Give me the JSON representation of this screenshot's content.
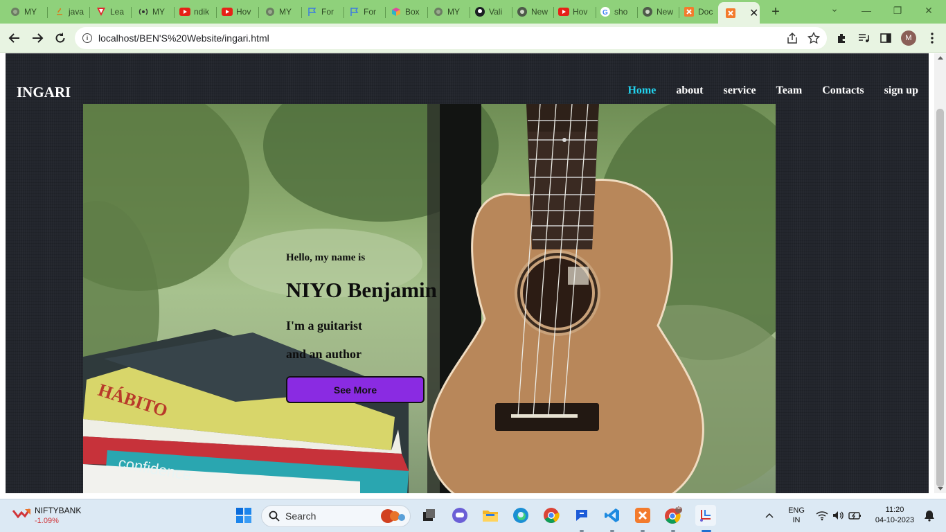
{
  "browser": {
    "tabs": [
      {
        "label": "MY",
        "icon": "globe-icon"
      },
      {
        "label": "java",
        "icon": "java-icon"
      },
      {
        "label": "Lea",
        "icon": "red-v-icon"
      },
      {
        "label": "MY",
        "icon": "podcast-icon"
      },
      {
        "label": "ndik",
        "icon": "youtube-icon"
      },
      {
        "label": "Hov",
        "icon": "youtube-icon"
      },
      {
        "label": "MY",
        "icon": "globe-icon"
      },
      {
        "label": "For",
        "icon": "flag-icon"
      },
      {
        "label": "For",
        "icon": "flag-icon"
      },
      {
        "label": "Box",
        "icon": "box-icon"
      },
      {
        "label": "MY",
        "icon": "globe-icon"
      },
      {
        "label": "Vali",
        "icon": "github-icon"
      },
      {
        "label": "New",
        "icon": "chrome-icon"
      },
      {
        "label": "Hov",
        "icon": "youtube-icon"
      },
      {
        "label": "sho",
        "icon": "google-icon"
      },
      {
        "label": "New",
        "icon": "chrome-icon"
      },
      {
        "label": "Doc",
        "icon": "xampp-icon"
      }
    ],
    "active_tab_icon": "xampp-icon",
    "active_tab_close": "✕",
    "new_tab": "+",
    "url": "localhost/BEN'S%20Website/ingari.html"
  },
  "site": {
    "brand": "INGARI",
    "nav": [
      {
        "label": "Home",
        "active": true
      },
      {
        "label": "about",
        "active": false
      },
      {
        "label": "service",
        "active": false
      },
      {
        "label": "Team",
        "active": false
      },
      {
        "label": "Contacts",
        "active": false
      },
      {
        "label": "sign up",
        "active": false
      }
    ],
    "hero": {
      "greeting": "Hello, my name is",
      "name": "NIYO Benjamin",
      "role_line1": "I'm a guitarist",
      "role_line2": "and an author",
      "button": "See More"
    },
    "colors": {
      "active_nav": "#22d3ee",
      "button": "#8a2be2",
      "page_bg": "#22252c"
    }
  },
  "taskbar": {
    "stock_name": "NIFTYBANK",
    "stock_change": "-1.09%",
    "search_label": "Search",
    "language": "ENG",
    "region": "IN",
    "time": "11:20",
    "date": "04-10-2023",
    "chrome_badge": "M"
  },
  "profile_initial": "M"
}
